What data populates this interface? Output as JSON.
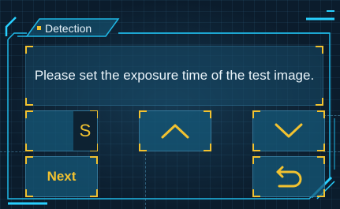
{
  "tab": {
    "label": "Detection"
  },
  "message": {
    "text": "Please set the exposure time of the test image."
  },
  "exposure": {
    "unit_label": "S"
  },
  "buttons": {
    "up_icon": "chevron-up-icon",
    "down_icon": "chevron-down-icon",
    "next_label": "Next",
    "back_icon": "return-arrow-icon"
  },
  "colors": {
    "accent": "#f2c230",
    "frame": "#1fb8e6",
    "background": "#0b1c2c",
    "button": "#16587a"
  }
}
